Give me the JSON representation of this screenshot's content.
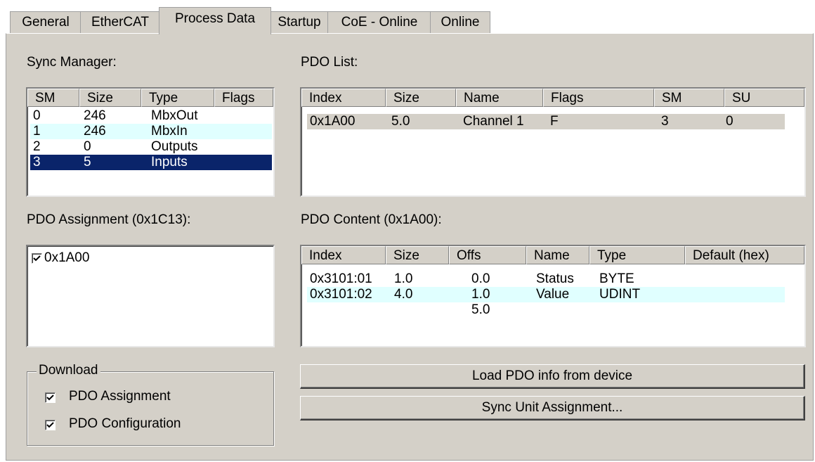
{
  "tabs": [
    "General",
    "EtherCAT",
    "Process Data",
    "Startup",
    "CoE - Online",
    "Online"
  ],
  "sync_manager": {
    "label": "Sync Manager:",
    "columns": [
      "SM",
      "Size",
      "Type",
      "Flags"
    ],
    "rows": [
      [
        "0",
        "246",
        "MbxOut",
        ""
      ],
      [
        "1",
        "246",
        "MbxIn",
        ""
      ],
      [
        "2",
        "0",
        "Outputs",
        ""
      ],
      [
        "3",
        "5",
        "Inputs",
        ""
      ]
    ]
  },
  "pdo_list": {
    "label": "PDO List:",
    "columns": [
      "Index",
      "Size",
      "Name",
      "Flags",
      "SM",
      "SU"
    ],
    "rows": [
      [
        "0x1A00",
        "5.0",
        "Channel 1",
        "F",
        "3",
        "0"
      ]
    ]
  },
  "pdo_assignment": {
    "label": "PDO Assignment (0x1C13):",
    "items": [
      {
        "label": "0x1A00",
        "checked": true
      }
    ]
  },
  "pdo_content": {
    "label": "PDO Content (0x1A00):",
    "columns": [
      "Index",
      "Size",
      "Offs",
      "Name",
      "Type",
      "Default (hex)"
    ],
    "rows": [
      [
        "0x3101:01",
        "1.0",
        "0.0",
        "Status",
        "BYTE",
        ""
      ],
      [
        "0x3101:02",
        "4.0",
        "1.0",
        "Value",
        "UDINT",
        ""
      ],
      [
        "",
        "",
        "5.0",
        "",
        "",
        ""
      ]
    ]
  },
  "download": {
    "title": "Download",
    "pdo_assignment": "PDO Assignment",
    "pdo_configuration": "PDO Configuration"
  },
  "buttons": {
    "load_pdo": "Load PDO info from device",
    "sync_unit": "Sync Unit Assignment..."
  }
}
